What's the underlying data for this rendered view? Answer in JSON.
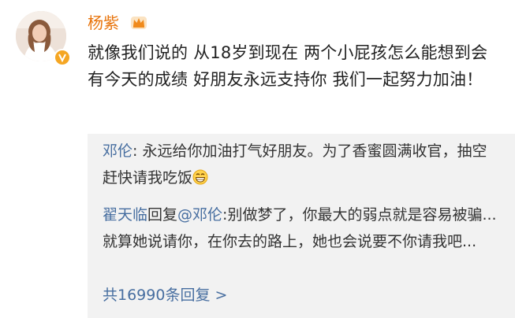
{
  "post": {
    "author": "杨紫",
    "author_badge_icon": "crown-icon",
    "verified_icon": "verified-v-icon",
    "text": "就像我们说的 从18岁到现在 两个小屁孩怎么能想到会有今天的成绩 好朋友永远支持你 我们一起努力加油！"
  },
  "comments": [
    {
      "user": "邓伦",
      "separator": ": ",
      "text": "永远给你加油打气好朋友。为了香蜜圆满收官，抽空赶快请我吃饭",
      "emoji": "grin-icon"
    },
    {
      "user": "翟天临",
      "reply_word": "回复",
      "reply_to": "@邓伦",
      "separator": ":",
      "text": "别做梦了，你最大的弱点就是容易被骗...就算她说请你，在你去的路上，她也会说要不你请我吧..."
    }
  ],
  "replies": {
    "count_label": "共16990条回复 >"
  },
  "colors": {
    "username": "#e8740c",
    "link": "#476ea0",
    "text": "#222222",
    "comment_bg": "#f2f2f2",
    "badge": "#f5a623"
  }
}
